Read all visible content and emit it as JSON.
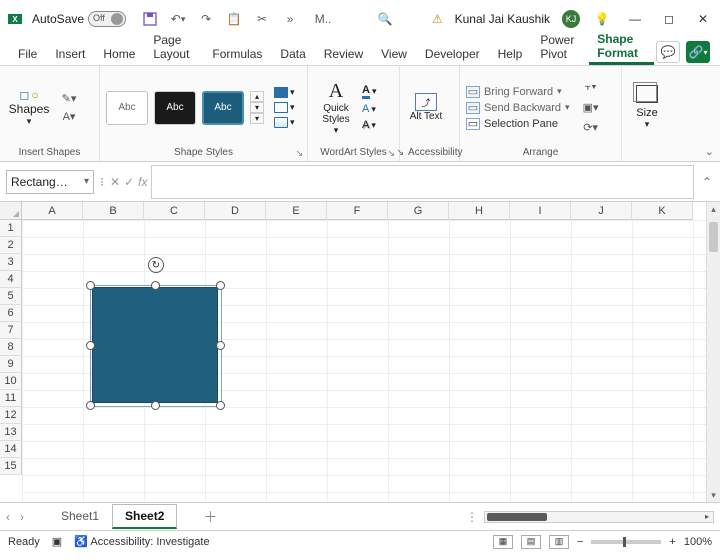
{
  "titlebar": {
    "autosave_label": "AutoSave",
    "autosave_off": "Off",
    "search_placeholder": "M..",
    "user_name": "Kunal Jai Kaushik",
    "user_initials": "KJ"
  },
  "ribbon_tabs": [
    "File",
    "Insert",
    "Home",
    "Page Layout",
    "Formulas",
    "Data",
    "Review",
    "View",
    "Developer",
    "Help",
    "Power Pivot",
    "Shape Format"
  ],
  "ribbon_active_tab": "Shape Format",
  "ribbon": {
    "insert_shapes": {
      "button": "Shapes",
      "group": "Insert Shapes"
    },
    "shape_styles": {
      "group": "Shape Styles",
      "gallery": [
        "Abc",
        "Abc",
        "Abc"
      ]
    },
    "wordart": {
      "group": "WordArt Styles",
      "quick_styles": "Quick Styles"
    },
    "alt_text": {
      "button": "Alt Text",
      "group": "Accessibility"
    },
    "arrange": {
      "group": "Arrange",
      "bring_forward": "Bring Forward",
      "send_backward": "Send Backward",
      "selection_pane": "Selection Pane"
    },
    "size": {
      "button": "Size"
    }
  },
  "namebox": "Rectang…",
  "columns": [
    "A",
    "B",
    "C",
    "D",
    "E",
    "F",
    "G",
    "H",
    "I",
    "J",
    "K"
  ],
  "rows": [
    "1",
    "2",
    "3",
    "4",
    "5",
    "6",
    "7",
    "8",
    "9",
    "10",
    "11",
    "12",
    "13",
    "14",
    "15"
  ],
  "sheets": {
    "sheet1": "Sheet1",
    "sheet2": "Sheet2"
  },
  "status": {
    "ready": "Ready",
    "accessibility": "Accessibility: Investigate",
    "zoom": "100%"
  }
}
